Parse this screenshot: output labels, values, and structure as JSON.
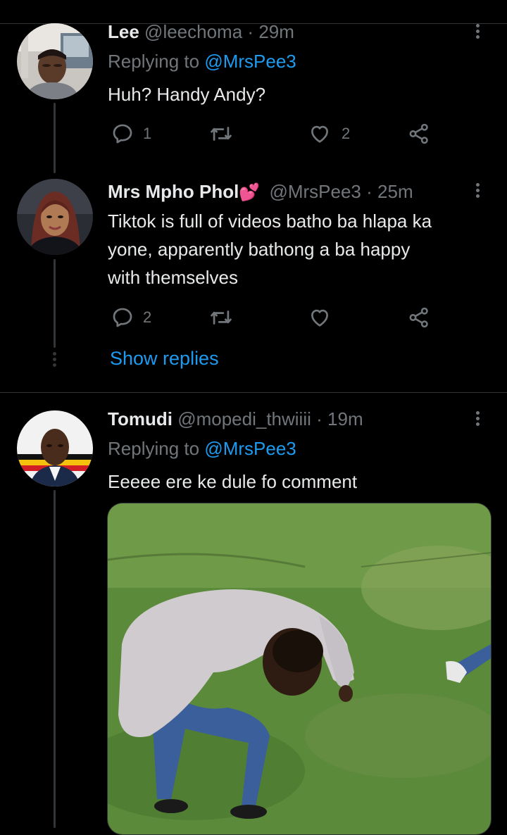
{
  "tweets": [
    {
      "name": "Lee",
      "handle": "@leechoma",
      "time": "29m",
      "replying_prefix": "Replying to",
      "replying_to": "@MrsPee3",
      "text": "Huh? Handy Andy?",
      "replies": "1",
      "retweets": "",
      "likes": "2"
    },
    {
      "name": "Mrs Mpho Phol",
      "name_emoji": "💕",
      "handle": "@MrsPee3",
      "time": "25m",
      "text_lines": [
        "Tiktok is full of videos batho ba hlapa ka",
        "yone, apparently bathong a ba happy",
        "with themselves"
      ],
      "replies": "2",
      "retweets": "",
      "likes": ""
    },
    {
      "name": "Tomudi",
      "handle": "@mopedi_thwiiii",
      "time": "19m",
      "replying_prefix": "Replying to",
      "replying_to": "@MrsPee3",
      "text": "Eeeee ere ke dule fo comment"
    }
  ],
  "show_replies": "Show replies",
  "separator": "·",
  "colors": {
    "accent": "#1d9bf0",
    "muted": "#71767b",
    "background": "#000000",
    "text": "#e7e9ea"
  }
}
